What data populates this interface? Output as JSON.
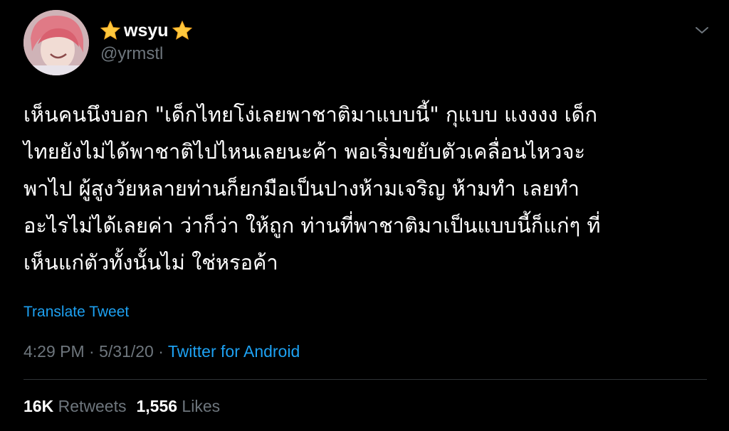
{
  "author": {
    "display_name": "wsyu",
    "handle": "@yrmstl",
    "avatar_icon": "profile-photo",
    "badge_icon": "star-emoji"
  },
  "menu": {
    "icon": "chevron-down-icon"
  },
  "tweet": {
    "lines": [
      "เห็นคนนึงบอก \"เด็กไทยโง่เลยพาชาติมาแบบนี้\" กุแบบ แงงงง เด็ก",
      "ไทยยังไม่ได้พาชาติไปไหนเลยนะค้า พอเริ่มขยับตัวเคลื่อนไหวจะ",
      "พาไป ผู้สูงวัยหลายท่านก็ยกมือเป็นปางห้ามเจริญ ห้ามทำ เลยทำ",
      "อะไรไม่ได้เลยค่า ว่าก็ว่า ให้ถูก ท่านที่พาชาติมาเป็นแบบนี้ก็แก่ๆ ที่",
      "เห็นแก่ตัวทั้งนั้นไม่ ใช่หรอค้า"
    ],
    "translate_label": "Translate Tweet",
    "time": "4:29 PM",
    "separator": " · ",
    "date": "5/31/20",
    "client": "Twitter for Android"
  },
  "stats": {
    "retweets_count": "16K",
    "retweets_label": "Retweets",
    "likes_count": "1,556",
    "likes_label": "Likes"
  },
  "colors": {
    "background": "#000000",
    "text": "#ffffff",
    "muted": "#6e767d",
    "link": "#1da1f2",
    "divider": "#2f3336",
    "star": "#ffc83d"
  }
}
